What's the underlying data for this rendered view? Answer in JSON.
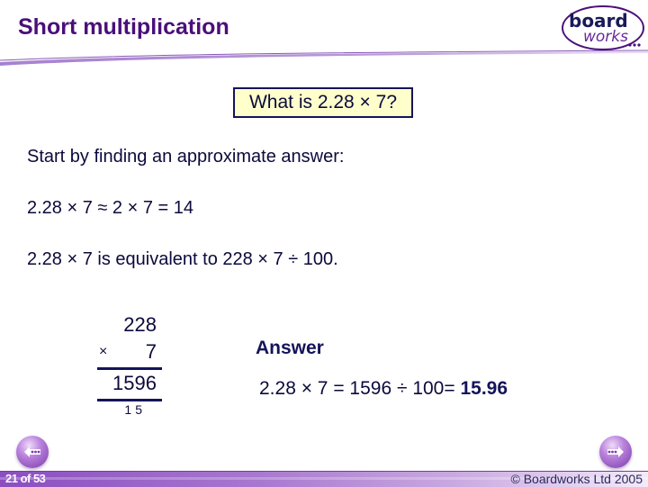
{
  "header": {
    "title": "Short multiplication",
    "logo": {
      "line1": "board",
      "line2": "works"
    }
  },
  "question": "What is 2.28 × 7?",
  "body": {
    "lines": [
      "Start by finding an approximate answer:",
      "2.28 × 7 ≈ 2 × 7 = 14",
      "2.28 × 7 is equivalent to 228 × 7 ÷ 100."
    ]
  },
  "working": {
    "multiplicand": "228",
    "operator": "×",
    "multiplier": "7",
    "product": "1596",
    "carries": "15"
  },
  "answer": {
    "label": "Answer",
    "expression": "2.28 × 7 = 1596 ÷ 100=",
    "result": "15.96"
  },
  "footer": {
    "page_count": "21 of 53",
    "copyright": "© Boardworks Ltd 2005",
    "prev_icon": "prev-arrow-icon",
    "next_icon": "next-arrow-icon"
  },
  "colors": {
    "title": "#4a0f7a",
    "accent": "#8a4ec0",
    "question_bg": "#ffffcc",
    "text": "#0a0a3c"
  }
}
